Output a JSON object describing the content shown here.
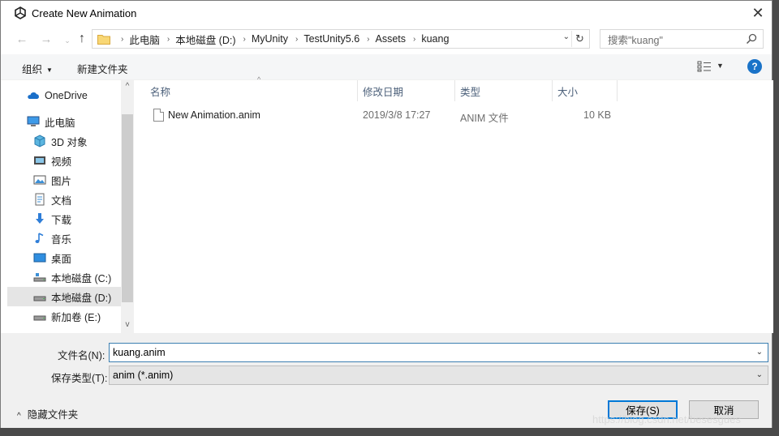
{
  "dialog": {
    "title": "Create New Animation",
    "close_glyph": "✕"
  },
  "nav": {
    "back_glyph": "←",
    "forward_glyph": "→",
    "recent_glyph": "⌄",
    "up_glyph": "↑",
    "breadcrumbs": [
      "此电脑",
      "本地磁盘 (D:)",
      "MyUnity",
      "TestUnity5.6",
      "Assets",
      "kuang"
    ],
    "crumb_separator": "›",
    "dropdown_glyph": "⌄",
    "refresh_glyph": "↻",
    "search_placeholder": "搜索\"kuang\""
  },
  "toolbar": {
    "organize_label": "组织",
    "organize_caret": "▼",
    "new_folder_label": "新建文件夹",
    "view_caret": "▼",
    "help_glyph": "?"
  },
  "sidebar": {
    "items": [
      {
        "label": "OneDrive",
        "icon": "cloud-icon"
      },
      {
        "label": "此电脑",
        "icon": "computer-icon"
      },
      {
        "label": "3D 对象",
        "icon": "cube-icon"
      },
      {
        "label": "视频",
        "icon": "video-icon"
      },
      {
        "label": "图片",
        "icon": "picture-icon"
      },
      {
        "label": "文档",
        "icon": "document-icon"
      },
      {
        "label": "下载",
        "icon": "download-icon"
      },
      {
        "label": "音乐",
        "icon": "music-icon"
      },
      {
        "label": "桌面",
        "icon": "desktop-icon"
      },
      {
        "label": "本地磁盘 (C:)",
        "icon": "drive-icon"
      },
      {
        "label": "本地磁盘 (D:)",
        "icon": "drive-icon",
        "selected": true
      },
      {
        "label": "新加卷 (E:)",
        "icon": "drive-icon"
      }
    ],
    "scroll_up_glyph": "^",
    "scroll_down_glyph": "v"
  },
  "files": {
    "columns": [
      "名称",
      "修改日期",
      "类型",
      "大小"
    ],
    "sort_glyph": "^",
    "rows": [
      {
        "name": "New Animation.anim",
        "modified": "2019/3/8 17:27",
        "type": "ANIM 文件",
        "size": "10 KB"
      }
    ]
  },
  "form": {
    "filename_label": "文件名(N):",
    "filename_value": "kuang.anim",
    "filetype_label": "保存类型(T):",
    "filetype_value": "anim (*.anim)",
    "dropdown_glyph": "⌄"
  },
  "footer": {
    "hide_folders_label": "隐藏文件夹",
    "hide_folders_glyph": "^",
    "save_label": "保存(S)",
    "cancel_label": "取消"
  },
  "watermark": "https://blog.csdn.net/besesgues",
  "colors": {
    "accent": "#0078d7",
    "help": "#1a73c8",
    "selected_bg": "#e5e5e5"
  }
}
